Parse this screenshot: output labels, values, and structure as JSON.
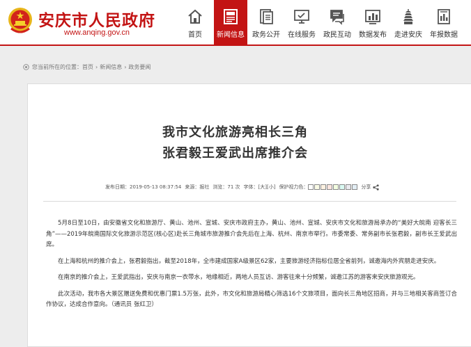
{
  "header": {
    "site_title": "安庆市人民政府",
    "site_url": "www.anqing.gov.cn",
    "brand_color": "#c31414",
    "nav": [
      {
        "label": "首页",
        "icon": "home-icon"
      },
      {
        "label": "新闻信息",
        "icon": "news-icon",
        "active": true
      },
      {
        "label": "政务公开",
        "icon": "document-icon"
      },
      {
        "label": "在线服务",
        "icon": "monitor-icon"
      },
      {
        "label": "政民互动",
        "icon": "chat-icon"
      },
      {
        "label": "数据发布",
        "icon": "bar-chart-icon"
      },
      {
        "label": "走进安庆",
        "icon": "pagoda-icon"
      },
      {
        "label": "年报数据",
        "icon": "report-icon"
      }
    ]
  },
  "breadcrumb": {
    "prefix": "您当前所在的位置：",
    "items": [
      "首页",
      "新闻信息",
      "政务要闻"
    ],
    "separator": "›"
  },
  "article": {
    "title_line1": "我市文化旅游亮相长三角",
    "title_line2": "张君毅王爱武出席推介会",
    "meta": {
      "publish": "发布日期：2019-05-13 08:37:54",
      "source": "来源：报社",
      "views": "浏览：71 次",
      "font_size_label": "字体：",
      "size_large": "[大]",
      "size_small": "[小]",
      "eye_protect": "保护视力色：",
      "eye_colors": [
        "#ffffff",
        "#fafbe6",
        "#fff2e2",
        "#fde6e0",
        "#f3ffe1",
        "#dafaf3",
        "#eaeaef",
        "#e3eef4"
      ],
      "share": "分享"
    },
    "paragraphs": [
      "5月8日至10日，由安徽省文化和旅游厅、黄山、池州、宣城、安庆市政府主办，黄山、池州、宣城、安庆市文化和旅游局承办的“美好大皖南 迎客长三角”——2019年皖南国际文化旅游示范区(核心区)赴长三角城市旅游推介会先后在上海、杭州、南京市举行。市委常委、常务副市长张君毅，副市长王爱武出席。",
      "在上海和杭州的推介会上，张君毅指出，截至2018年，全市建成国家A级景区62家，主要旅游经济指标位居全省前列，诚邀海内外宾朋走进安庆。",
      "在南京的推介会上，王爱武指出，安庆与南京一衣带水，地缘相近，两地人员互访、游客往来十分频繁，诚邀江苏的游客来安庆旅游观光。",
      "此次活动，我市各大景区赠送免费和优惠门票1.5万张，此外，市文化和旅游局精心筛选16个文旅项目，面向长三角地区招商，并与三地相关客商签订合作协议，达成合作意向。（通讯员 张红卫）"
    ]
  }
}
